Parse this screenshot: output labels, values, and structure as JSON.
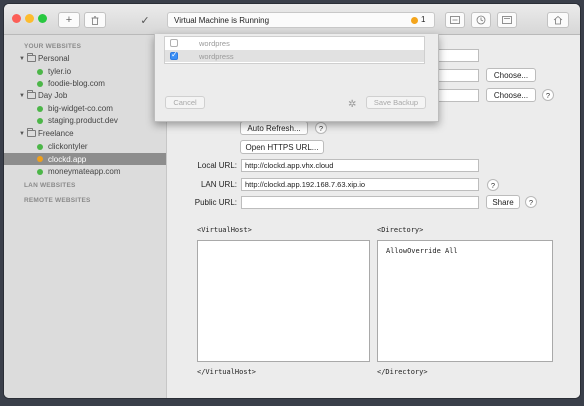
{
  "toolbar": {
    "status_text": "Virtual Machine is Running",
    "status_count": "1",
    "add_symbol": "+",
    "check_symbol": "✓"
  },
  "sidebar": {
    "your_websites": "YOUR WEBSITES",
    "groups": [
      {
        "label": "Personal",
        "items": [
          "tyler.io",
          "foodie-blog.com"
        ]
      },
      {
        "label": "Day Job",
        "items": [
          "big-widget-co.com",
          "staging.product.dev"
        ]
      },
      {
        "label": "Freelance",
        "items": [
          "clickontyler",
          "clockd.app",
          "moneymateapp.com"
        ]
      }
    ],
    "lan_websites": "LAN WEBSITES",
    "remote_websites": "REMOTE WEBSITES"
  },
  "sheet": {
    "rows": [
      {
        "name": "wordpres",
        "checked": false
      },
      {
        "name": "wordpress",
        "checked": true
      }
    ],
    "cancel_label": "Cancel",
    "save_label": "Save Backup"
  },
  "main": {
    "choose_label": "Choose...",
    "auto_refresh_label": "Auto Refresh...",
    "open_https_label": "Open HTTPS URL...",
    "local_url_label": "Local URL:",
    "local_url_value": "http://clockd.app.vhx.cloud",
    "lan_url_label": "LAN URL:",
    "lan_url_value": "http://clockd.app.192.168.7.63.xip.io",
    "public_url_label": "Public URL:",
    "public_url_value": "",
    "share_label": "Share",
    "help_symbol": "?",
    "vhost_open": "<VirtualHost>",
    "vhost_close": "</VirtualHost>",
    "dir_open": "<Directory>",
    "dir_close": "</Directory>",
    "dir_content": "AllowOverride All"
  },
  "colors": {
    "running_dot": "#f4a51c",
    "site_dot": "#4cb648",
    "selected_row": "#8d8d8d",
    "checkbox_checked": "#3b8ff5"
  }
}
